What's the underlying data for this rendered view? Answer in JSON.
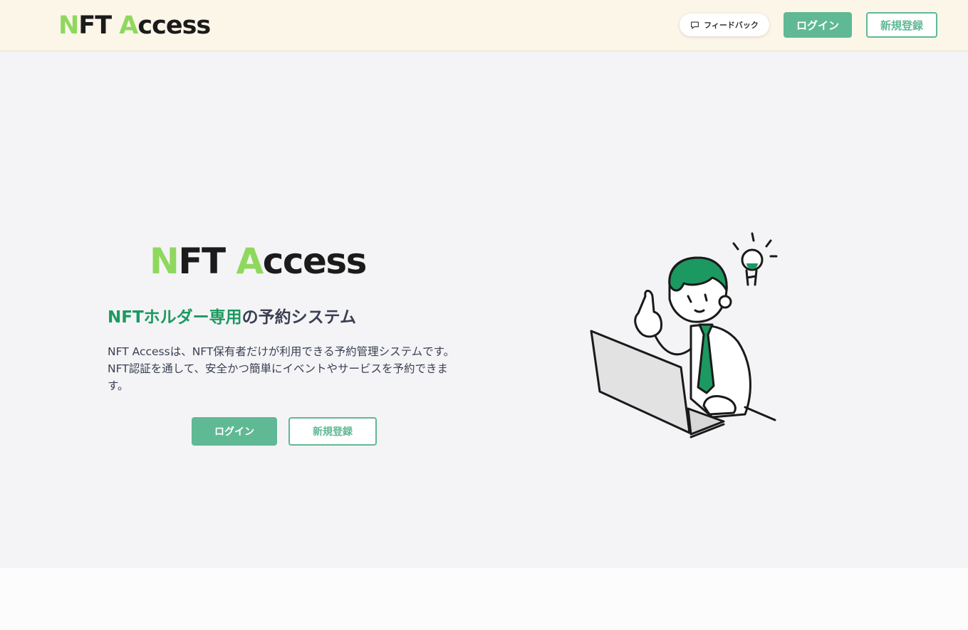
{
  "header": {
    "logo": {
      "part1": "N",
      "part2": "FT ",
      "part3": "A",
      "part4": "ccess"
    },
    "feedback_label": "フィードバック",
    "login_label": "ログイン",
    "register_label": "新規登録"
  },
  "hero": {
    "logo": {
      "part1": "N",
      "part2": "FT ",
      "part3": "A",
      "part4": "ccess"
    },
    "tagline_accent": "NFTホルダー専用",
    "tagline_rest": "の予約システム",
    "description": "NFT Accessは、NFT保有者だけが利用できる予約管理システムです。NFT認証を通して、安全かつ簡単にイベントやサービスを予約できます。",
    "login_label": "ログイン",
    "register_label": "新規登録"
  },
  "colors": {
    "accent_green": "#5fb994",
    "tagline_green": "#1c9960",
    "logo_green": "#8fd85e",
    "header_bg": "#fcf6e8"
  },
  "icons": {
    "feedback": "speech-bubble-icon"
  }
}
